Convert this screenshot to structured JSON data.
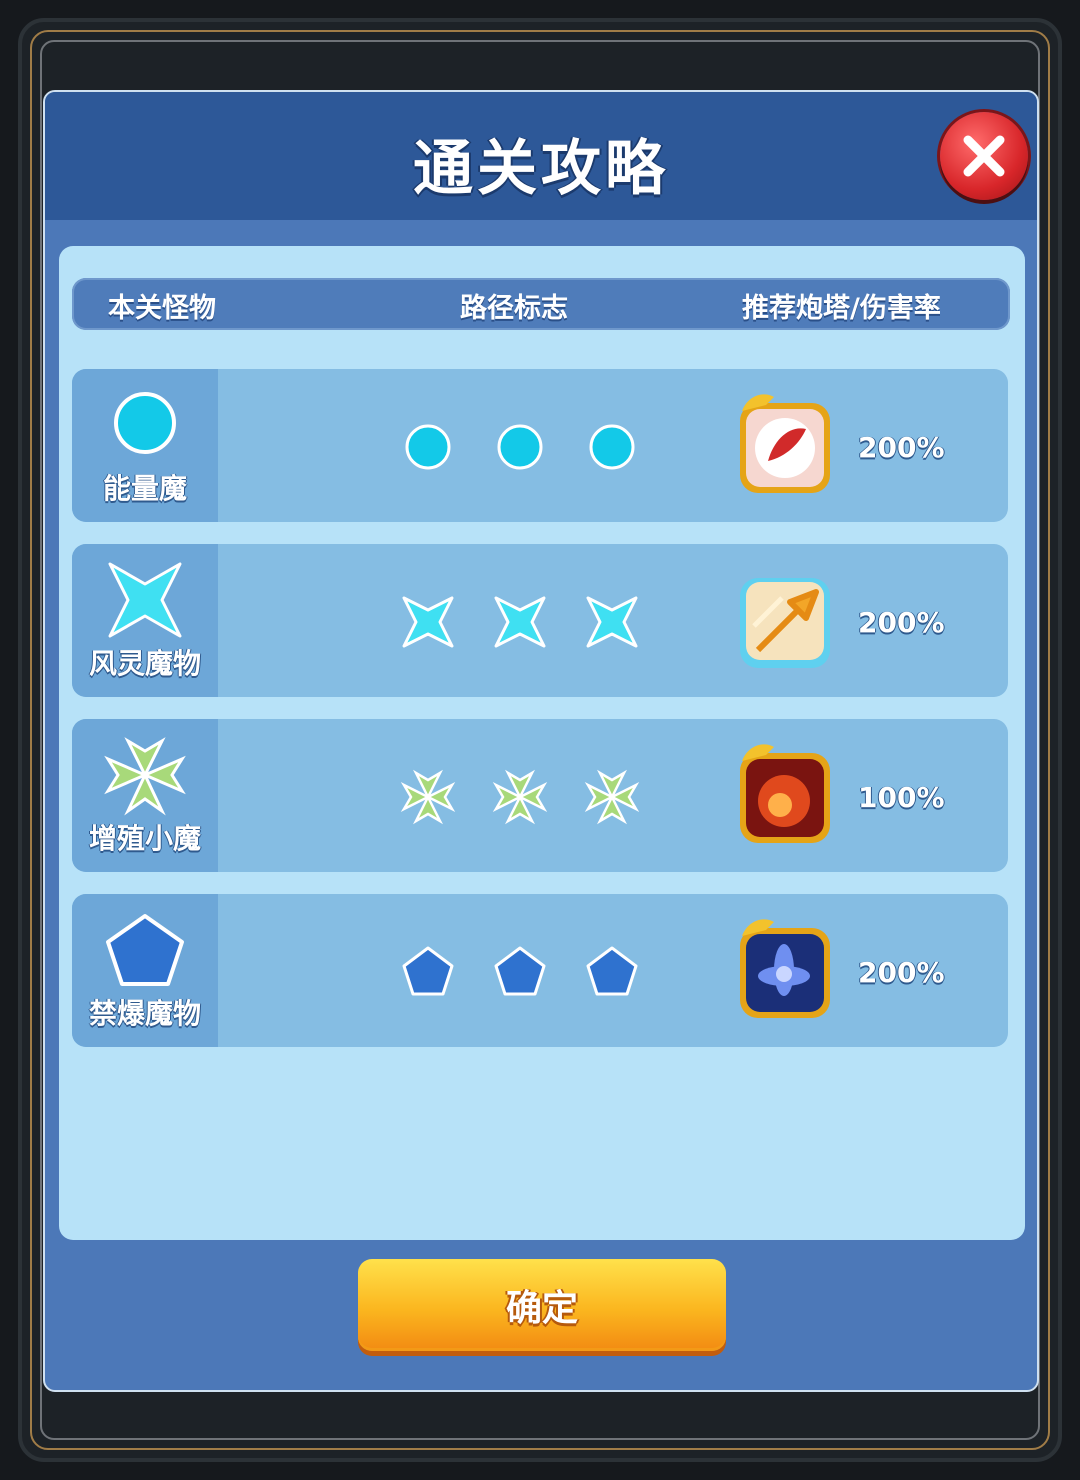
{
  "dialog": {
    "title": "通关攻略",
    "confirm_label": "确定"
  },
  "table": {
    "headers": [
      "本关怪物",
      "路径标志",
      "推荐炮塔/伤害率"
    ]
  },
  "rows": [
    {
      "monster": "能量魔",
      "shape": "circle",
      "color": "#13c9e8",
      "tower": "red-feather-tower-icon",
      "rate": "200%"
    },
    {
      "monster": "风灵魔物",
      "shape": "star4",
      "color": "#3fe0f2",
      "tower": "arrow-tower-icon",
      "rate": "200%"
    },
    {
      "monster": "增殖小魔",
      "shape": "clover",
      "color": "#a8d97a",
      "tower": "fire-tower-icon",
      "rate": "100%"
    },
    {
      "monster": "禁爆魔物",
      "shape": "pentagon",
      "color": "#2f72cf",
      "tower": "blue-flower-tower-icon",
      "rate": "200%"
    }
  ]
}
